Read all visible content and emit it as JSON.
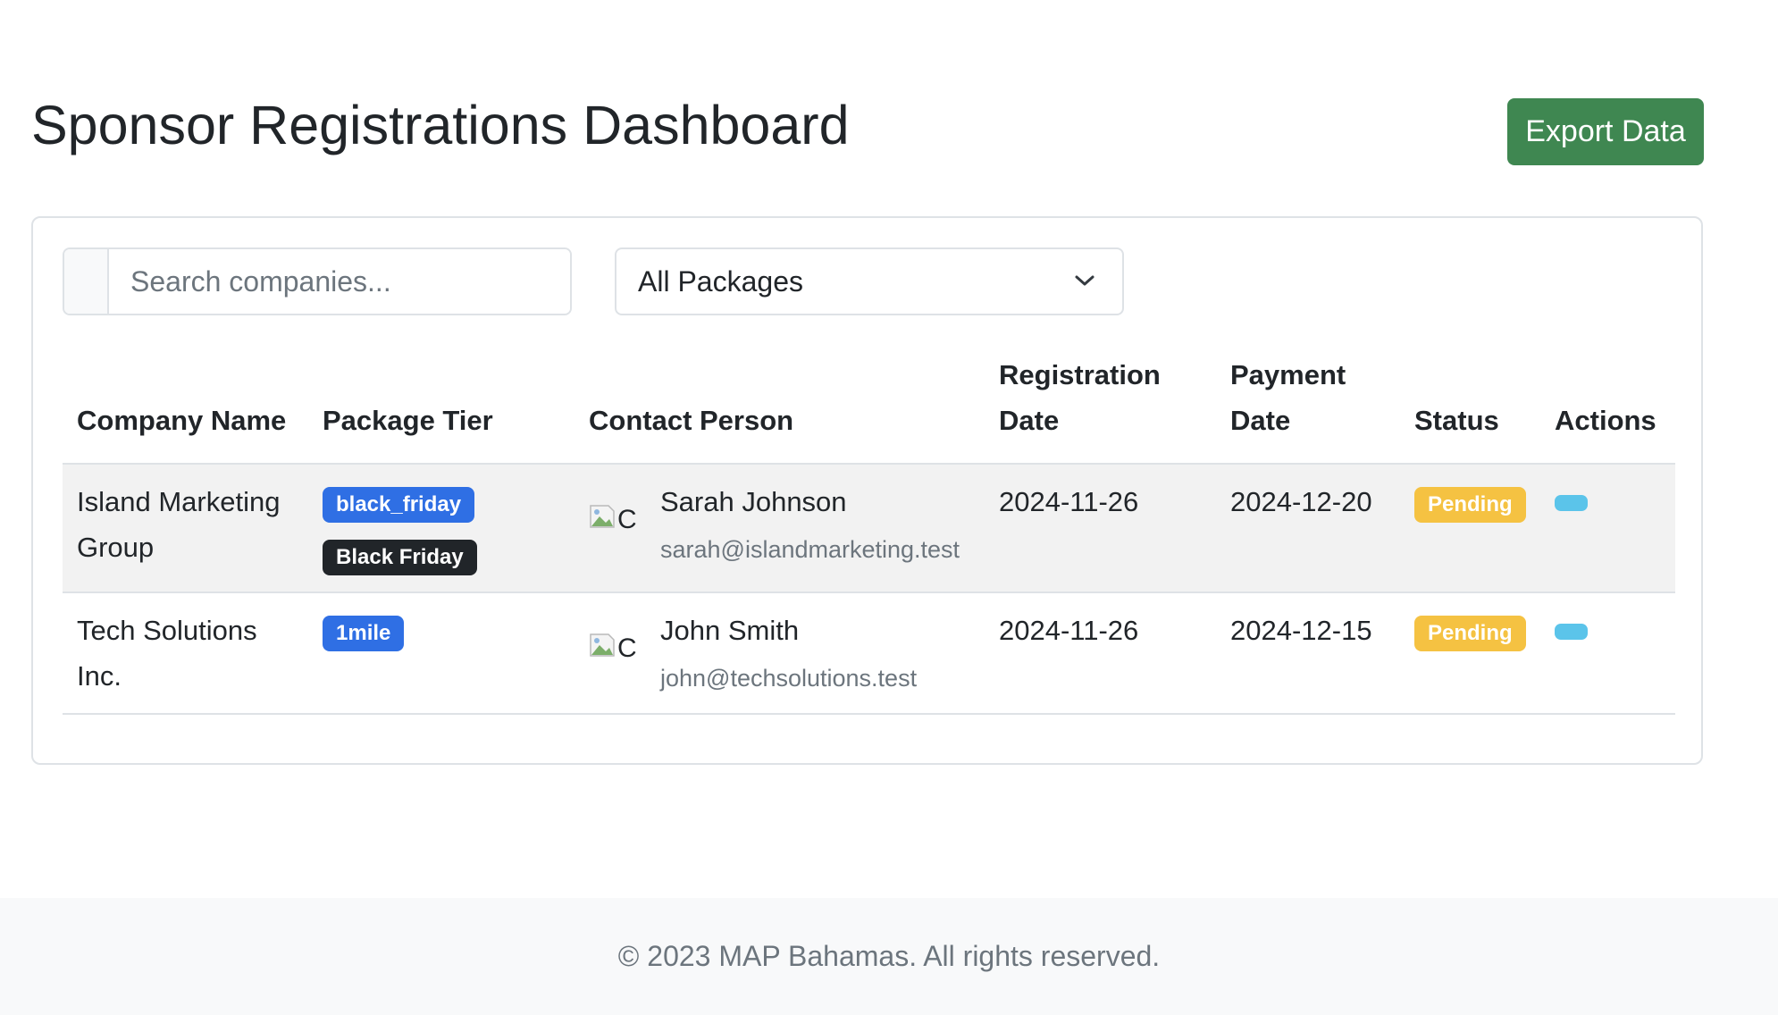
{
  "header": {
    "title": "Sponsor Registrations Dashboard",
    "export_label": "Export Data"
  },
  "filters": {
    "search_placeholder": "Search companies...",
    "search_value": "",
    "package_selected": "All Packages"
  },
  "table": {
    "columns": {
      "company": "Company Name",
      "package": "Package Tier",
      "contact": "Contact Person",
      "registration_date": "Registration Date",
      "payment_date": "Payment Date",
      "status": "Status",
      "actions": "Actions"
    },
    "rows": [
      {
        "company": "Island Marketing Group",
        "packages": [
          "black_friday",
          "Black Friday"
        ],
        "contact_avatar_alt": "C",
        "contact_name": "Sarah Johnson",
        "contact_email": "sarah@islandmarketing.test",
        "registration_date": "2024-11-26",
        "payment_date": "2024-12-20",
        "status": "Pending"
      },
      {
        "company": "Tech Solutions Inc.",
        "packages": [
          "1mile"
        ],
        "contact_avatar_alt": "C",
        "contact_name": "John Smith",
        "contact_email": "john@techsolutions.test",
        "registration_date": "2024-11-26",
        "payment_date": "2024-12-15",
        "status": "Pending"
      }
    ]
  },
  "footer": {
    "text": "© 2023 MAP Bahamas. All rights reserved."
  },
  "colors": {
    "export_button": "#3f8751",
    "badge_primary": "#2f6fe4",
    "badge_dark": "#212529",
    "status_pending": "#f5c242",
    "action_button": "#5bc4ea"
  }
}
